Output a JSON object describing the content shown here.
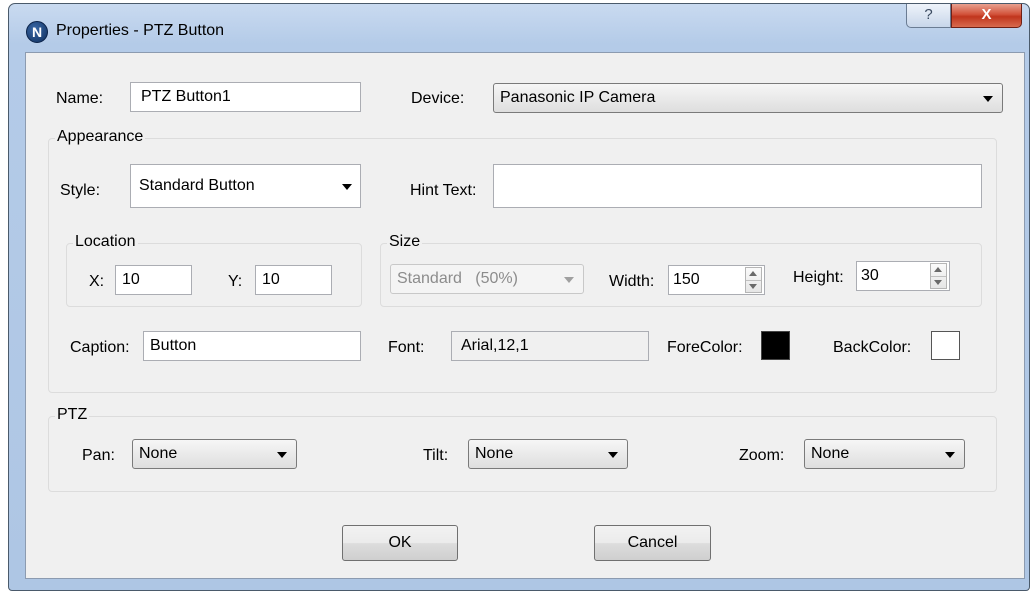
{
  "window": {
    "title": "Properties - PTZ Button",
    "icon": "N",
    "help_glyph": "?",
    "close_glyph": "X"
  },
  "general": {
    "name_label": "Name:",
    "name_value": "PTZ Button1",
    "device_label": "Device:",
    "device_value": "Panasonic IP Camera"
  },
  "appearance": {
    "group_label": "Appearance",
    "style_label": "Style:",
    "style_value": "Standard Button",
    "hint_label": "Hint Text:",
    "hint_value": "",
    "location": {
      "group_label": "Location",
      "x_label": "X:",
      "x_value": "10",
      "y_label": "Y:",
      "y_value": "10"
    },
    "size": {
      "group_label": "Size",
      "preset_value": "Standard   (50%)",
      "width_label": "Width:",
      "width_value": "150",
      "height_label": "Height:",
      "height_value": "30"
    },
    "caption_label": "Caption:",
    "caption_value": "Button",
    "font_label": "Font:",
    "font_value": "Arial,12,1",
    "forecolor_label": "ForeColor:",
    "forecolor": "#000000",
    "backcolor_label": "BackColor:",
    "backcolor": "#ffffff"
  },
  "ptz": {
    "group_label": "PTZ",
    "pan_label": "Pan:",
    "pan_value": "None",
    "tilt_label": "Tilt:",
    "tilt_value": "None",
    "zoom_label": "Zoom:",
    "zoom_value": "None"
  },
  "buttons": {
    "ok_label": "OK",
    "cancel_label": "Cancel"
  }
}
